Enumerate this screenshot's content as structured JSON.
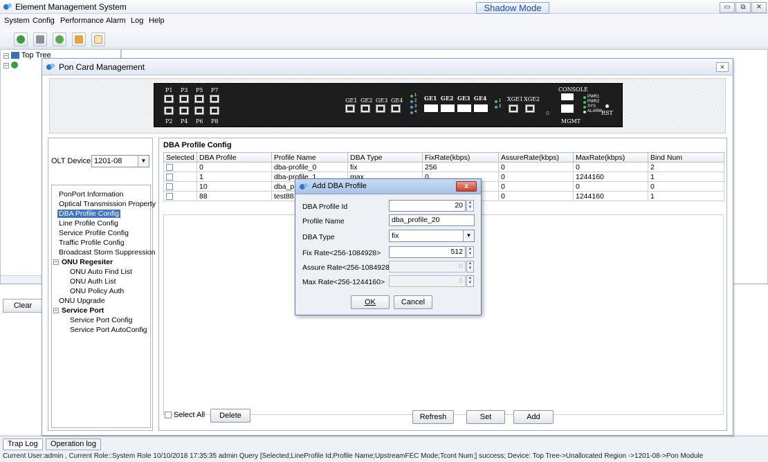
{
  "app": {
    "title": "Element Management System",
    "shadow_mode": "Shadow Mode",
    "window_buttons": [
      "minimize",
      "maximize",
      "close"
    ]
  },
  "menu": [
    "System",
    "Config",
    "Performance",
    "Alarm",
    "Log",
    "Help"
  ],
  "toolbar_icons": [
    "topology-icon",
    "device-icon",
    "settings-icon",
    "report-icon",
    "document-icon"
  ],
  "tree": {
    "root": "Top Tree"
  },
  "bottom": {
    "clear_label": "Clear",
    "tabs": [
      "Trap Log",
      "Operation log"
    ],
    "status": "Current User:admin , Current Role::System Role    10/10/2018 17:35:35  admin  Query [Selected;LineProfile Id;Profile Name;UpstreamFEC Mode;Tcont Num;] success; Device: Top Tree->Unallocated Region ->1201-08->Pon Module"
  },
  "pcm": {
    "title": "Pon Card Management",
    "card": {
      "pon_top": [
        "P1",
        "P3",
        "P5",
        "P7"
      ],
      "pon_bottom": [
        "P2",
        "P4",
        "P6",
        "P8"
      ],
      "ge_sfp": [
        "GE1",
        "GE2",
        "GE3",
        "GE4"
      ],
      "ge_rj45": [
        "GE1",
        "GE2",
        "GE3",
        "GE4"
      ],
      "xge": [
        "XGE1",
        "XGE2"
      ],
      "console": "CONSOLE",
      "mgmt": "MGMT",
      "leds": [
        "PWR1",
        "PWR2",
        "SYS",
        "ALARM"
      ],
      "rst": "RST",
      "ge_led_nums": [
        "1",
        "2",
        "3",
        "4"
      ],
      "xge_led_nums": [
        "1",
        "2"
      ]
    },
    "olt_label": "OLT Device",
    "olt_value": "1201-08",
    "menu_items": [
      {
        "label": "PonPort Information",
        "type": "item"
      },
      {
        "label": "Optical Transmission Property",
        "type": "item"
      },
      {
        "label": "DBA Profile Config",
        "type": "selected"
      },
      {
        "label": "Line Profile Config",
        "type": "item"
      },
      {
        "label": "Service Profile Config",
        "type": "item"
      },
      {
        "label": "Traffic Profile Config",
        "type": "item"
      },
      {
        "label": "Broadcast Storm Suppression",
        "type": "item"
      },
      {
        "label": "ONU Regesiter",
        "type": "group"
      },
      {
        "label": "ONU Auto Find List",
        "type": "sub"
      },
      {
        "label": "ONU Auth List",
        "type": "sub"
      },
      {
        "label": "ONU Policy Auth",
        "type": "sub"
      },
      {
        "label": "ONU Upgrade",
        "type": "item"
      },
      {
        "label": "Service Port",
        "type": "group"
      },
      {
        "label": "Service Port Config",
        "type": "sub"
      },
      {
        "label": "Service Port AutoConfig",
        "type": "sub"
      }
    ],
    "dba": {
      "heading": "DBA Profile Config",
      "columns": [
        "Selected",
        "DBA Profile",
        "Profile Name",
        "DBA Type",
        "FixRate(kbps)",
        "AssureRate(kbps)",
        "MaxRate(kbps)",
        "Bind Num"
      ],
      "rows": [
        [
          "0",
          "dba-profile_0",
          "fix",
          "256",
          "0",
          "0",
          "2"
        ],
        [
          "1",
          "dba-profile_1",
          "max",
          "0",
          "0",
          "1244160",
          "1"
        ],
        [
          "10",
          "dba_pro",
          "",
          "",
          "0",
          "0",
          "0"
        ],
        [
          "88",
          "test88",
          "",
          "",
          "0",
          "1244160",
          "1"
        ]
      ],
      "select_all": "Select All",
      "delete": "Delete",
      "refresh": "Refresh",
      "set": "Set",
      "add": "Add"
    }
  },
  "dialog": {
    "title": "Add DBA Profile",
    "close": "x",
    "fields": {
      "profile_id": {
        "label": "DBA Profile Id",
        "value": "20"
      },
      "profile_name": {
        "label": "Profile Name",
        "value": "dba_profile_20"
      },
      "dba_type": {
        "label": "DBA Type",
        "value": "fix"
      },
      "fix_rate": {
        "label": "Fix Rate<256-1084928>",
        "value": "512"
      },
      "assure_rate": {
        "label": "Assure Rate<256-1084928>",
        "value": "0"
      },
      "max_rate": {
        "label": "Max Rate<256-1244160>",
        "value": "0"
      }
    },
    "ok": "OK",
    "cancel": "Cancel"
  },
  "colors": {
    "selection": "#3d74c7",
    "shadow_mode_text": "#1b48b8",
    "led_green": "#46c54a",
    "dialog_close": "#c9432f"
  }
}
